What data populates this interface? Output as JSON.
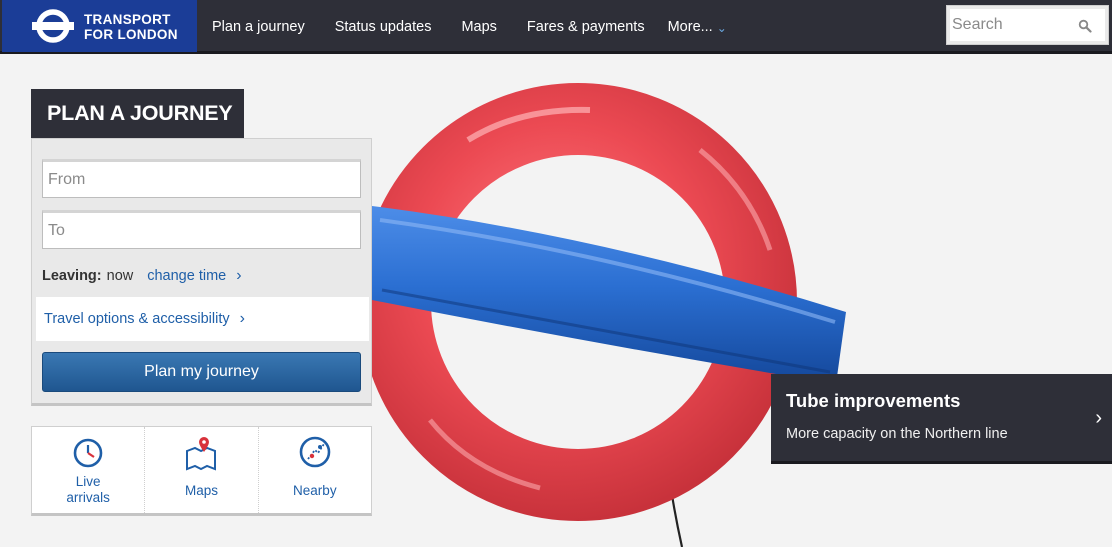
{
  "brand": {
    "line1": "TRANSPORT",
    "line2": "FOR LONDON",
    "color": "#1b3d97"
  },
  "nav": {
    "items": [
      "Plan a journey",
      "Status updates",
      "Maps",
      "Fares & payments"
    ],
    "more_label": "More...",
    "more_icon": "chevron-down-icon"
  },
  "search": {
    "placeholder": "Search",
    "icon": "search-icon"
  },
  "planner": {
    "title": "PLAN A JOURNEY",
    "from_placeholder": "From",
    "to_placeholder": "To",
    "leaving_label": "Leaving:",
    "leaving_value": "now",
    "change_time": "change time",
    "travel_options": "Travel options & accessibility",
    "submit": "Plan my journey"
  },
  "quick_links": [
    {
      "line1": "Live",
      "line2": "arrivals",
      "icon": "clock-icon"
    },
    {
      "line1": "Maps",
      "line2": "",
      "icon": "map-pin-icon"
    },
    {
      "line1": "Nearby",
      "line2": "",
      "icon": "compass-icon"
    }
  ],
  "promo": {
    "title": "Tube improvements",
    "subtitle": "More capacity on the Northern line",
    "icon": "chevron-right-icon"
  },
  "colors": {
    "header": "#2e2f38",
    "link": "#1f5fa8",
    "button": "#1f5690",
    "roundel_red": "#e8414b",
    "roundel_blue": "#1e5fc0"
  }
}
